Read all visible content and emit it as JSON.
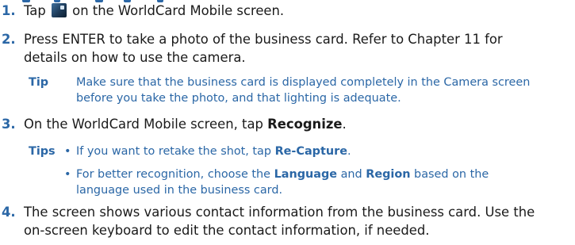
{
  "steps": [
    {
      "number": "1.",
      "before_icon": "Tap ",
      "icon": "worldcard-camera-icon",
      "after_icon": " on the WorldCard Mobile screen."
    },
    {
      "number": "2.",
      "line1": "Press ENTER to take a photo of the business card. Refer to Chapter 11 for",
      "line2": "details on how to use the camera."
    },
    {
      "number": "3.",
      "before_bold": "On the WorldCard Mobile screen, tap ",
      "bold": "Recognize",
      "after_bold": "."
    },
    {
      "number": "4.",
      "line1": "The screen shows various contact information from the business card. Use the",
      "line2": "on-screen keyboard to edit the contact information, if needed."
    }
  ],
  "tip": {
    "label": "Tip",
    "line1": "Make sure that the business card is displayed completely in the Camera screen",
    "line2": "before you take the photo, and that lighting is adequate."
  },
  "tips": {
    "label": "Tips",
    "bullet": "•",
    "item1": {
      "before": "If you want to retake the shot, tap ",
      "bold": "Re-Capture",
      "after": "."
    },
    "item2": {
      "before": "For better recognition, choose the ",
      "bold1": "Language",
      "middle": " and ",
      "bold2": "Region",
      "after": " based on the",
      "line2": "language used in the business card."
    }
  },
  "colors": {
    "accent": "#2b67a6",
    "text": "#1a1a1a"
  }
}
